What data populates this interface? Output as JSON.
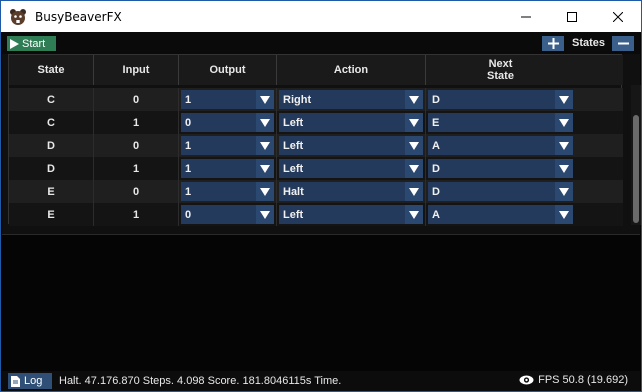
{
  "window": {
    "title": "BusyBeaverFX",
    "controls": {
      "minimize": "minimize-icon",
      "maximize": "maximize-icon",
      "close": "close-icon"
    }
  },
  "toolbar": {
    "start_label": "Start",
    "states_label": "States",
    "add_icon": "plus-icon",
    "remove_icon": "minus-icon"
  },
  "table": {
    "headers": [
      "State",
      "Input",
      "Output",
      "Action",
      "Next\nState"
    ],
    "rows": [
      {
        "state": "C",
        "input": "0",
        "output": "1",
        "action": "Right",
        "next": "D"
      },
      {
        "state": "C",
        "input": "1",
        "output": "0",
        "action": "Left",
        "next": "E"
      },
      {
        "state": "D",
        "input": "0",
        "output": "1",
        "action": "Left",
        "next": "A"
      },
      {
        "state": "D",
        "input": "1",
        "output": "1",
        "action": "Left",
        "next": "D"
      },
      {
        "state": "E",
        "input": "0",
        "output": "1",
        "action": "Halt",
        "next": "D"
      },
      {
        "state": "E",
        "input": "1",
        "output": "0",
        "action": "Left",
        "next": "A"
      }
    ]
  },
  "status": {
    "log_label": "Log",
    "message": "Halt. 47.176.870 Steps. 4.098 Score. 181.8046115s Time.",
    "fps": "FPS 50.8 (19.692)"
  },
  "colors": {
    "accent": "#2f7d55",
    "combo_bg": "#243a5c",
    "button_blue": "#3a5f8a",
    "window_border": "#1e5aa8"
  }
}
